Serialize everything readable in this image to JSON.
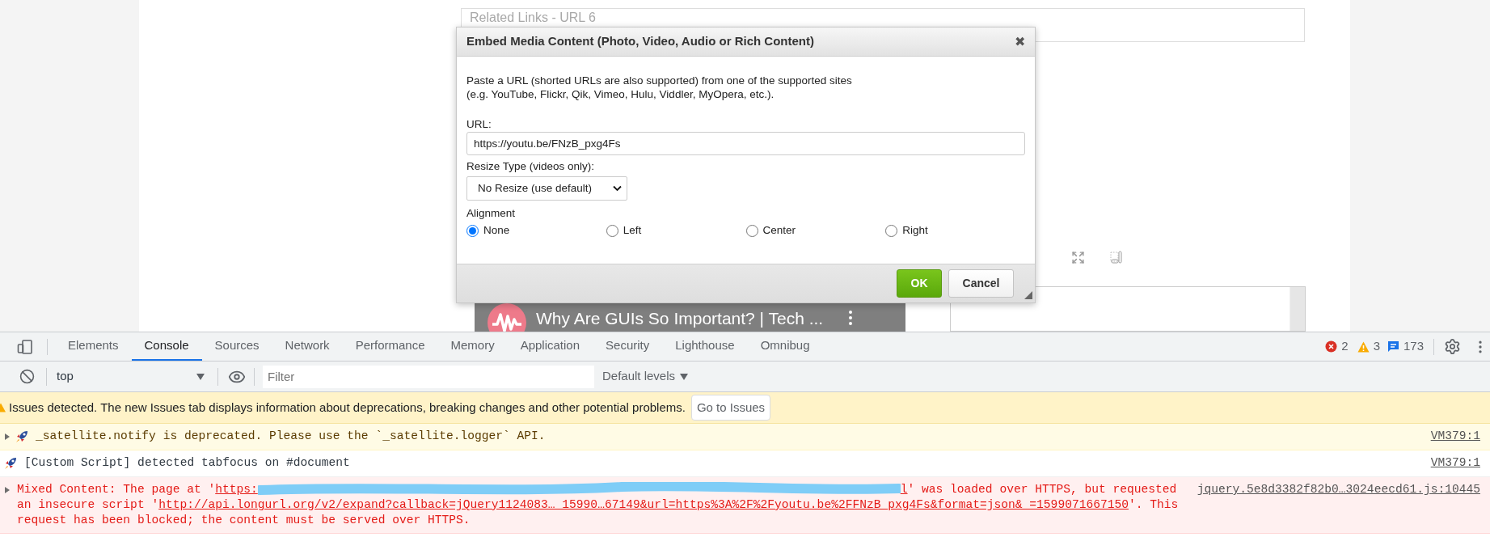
{
  "page": {
    "related_links_placeholder": "Related Links - URL 6",
    "video_title": "Why Are GUIs So Important? | Tech ..."
  },
  "dialog": {
    "title": "Embed Media Content (Photo, Video, Audio or Rich Content)",
    "close": "✖",
    "description": "Paste a URL (shorted URLs are also supported) from one of the supported sites (e.g. YouTube, Flickr, Qik, Vimeo, Hulu, Viddler, MyOpera, etc.).",
    "url_label": "URL:",
    "url_value": "https://youtu.be/FNzB_pxg4Fs",
    "resize_label": "Resize Type (videos only):",
    "resize_value": "No Resize (use default)",
    "alignment_label": "Alignment",
    "alignment_options": [
      {
        "label": "None",
        "selected": true
      },
      {
        "label": "Left",
        "selected": false
      },
      {
        "label": "Center",
        "selected": false
      },
      {
        "label": "Right",
        "selected": false
      }
    ],
    "buttons": [
      {
        "label": "OK",
        "kind": "primary"
      },
      {
        "label": "Cancel",
        "kind": "secondary"
      }
    ]
  },
  "devtools": {
    "tabs": [
      {
        "label": "Elements",
        "selected": false
      },
      {
        "label": "Console",
        "selected": true
      },
      {
        "label": "Sources",
        "selected": false
      },
      {
        "label": "Network",
        "selected": false
      },
      {
        "label": "Performance",
        "selected": false
      },
      {
        "label": "Memory",
        "selected": false
      },
      {
        "label": "Application",
        "selected": false
      },
      {
        "label": "Security",
        "selected": false
      },
      {
        "label": "Lighthouse",
        "selected": false
      },
      {
        "label": "Omnibug",
        "selected": false
      }
    ],
    "counts": {
      "errors": "2",
      "warnings": "3",
      "messages": "173"
    },
    "context": "top",
    "filter_placeholder": "Filter",
    "levels": "Default levels",
    "issues_bar": {
      "text": "Issues detected. The new Issues tab displays information about deprecations, breaking changes and other potential problems.",
      "button": "Go to Issues"
    },
    "messages": [
      {
        "kind": "warning",
        "expandable": true,
        "icon": true,
        "source": "VM379:1",
        "parts": [
          {
            "kind": "text",
            "text": "_satellite.notify is deprecated. Please use the `_satellite.logger` API."
          }
        ]
      },
      {
        "kind": "info",
        "expandable": false,
        "icon": true,
        "source": "VM379:1",
        "parts": [
          {
            "kind": "text",
            "text": "[Custom Script] detected tabfocus on #document"
          }
        ]
      },
      {
        "kind": "error",
        "expandable": true,
        "icon": false,
        "source": "jquery.5e8d3382f82b0…3024eecd61.js:10445",
        "parts": [
          {
            "kind": "text",
            "text": "Mixed Content: The page at '"
          },
          {
            "kind": "link",
            "text": "https:"
          },
          {
            "kind": "redacted"
          },
          {
            "kind": "link",
            "text": "l"
          },
          {
            "kind": "text",
            "text": "' was loaded over HTTPS, but requested an insecure script '"
          },
          {
            "kind": "link",
            "text": "http://api.longurl.org/v2/expand?callback=jQuery1124083…_15990…67149&url=https%3A%2F%2Fyoutu.be%2FFNzB_pxg4Fs&format=json&_=1599071667150"
          },
          {
            "kind": "text",
            "text": "'. This request has been blocked; the content must be served over HTTPS."
          }
        ]
      }
    ]
  }
}
